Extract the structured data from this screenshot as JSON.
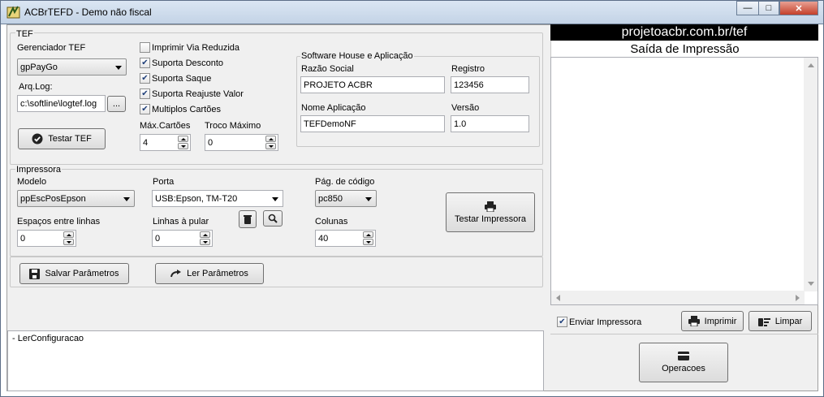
{
  "window": {
    "title": "ACBrTEFD - Demo não fiscal"
  },
  "tef": {
    "group_title": "TEF",
    "gerenciador_label": "Gerenciador TEF",
    "gerenciador_value": "gpPayGo",
    "arqlog_label": "Arq.Log:",
    "arqlog_value": "c:\\softline\\logtef.log",
    "browse_label": "...",
    "testar_label": "Testar TEF",
    "options": [
      {
        "label": "Imprimir Via Reduzida",
        "checked": false
      },
      {
        "label": "Suporta Desconto",
        "checked": true
      },
      {
        "label": "Suporta Saque",
        "checked": true
      },
      {
        "label": "Suporta Reajuste Valor",
        "checked": true
      },
      {
        "label": "Multiplos Cartões",
        "checked": true
      }
    ],
    "max_cartoes_label": "Máx.Cartões",
    "max_cartoes_value": "4",
    "troco_label": "Troco Máximo",
    "troco_value": "0"
  },
  "software_house": {
    "group_title": "Software House e Aplicação",
    "razao_label": "Razão Social",
    "razao_value": "PROJETO ACBR",
    "registro_label": "Registro",
    "registro_value": "123456",
    "nome_label": "Nome Aplicação",
    "nome_value": "TEFDemoNF",
    "versao_label": "Versão",
    "versao_value": "1.0"
  },
  "impressora": {
    "group_title": "Impressora",
    "modelo_label": "Modelo",
    "modelo_value": "ppEscPosEpson",
    "porta_label": "Porta",
    "porta_value": "USB:Epson, TM-T20",
    "pagcod_label": "Pág. de código",
    "pagcod_value": "pc850",
    "espacos_label": "Espaços entre linhas",
    "espacos_value": "0",
    "linhas_label": "Linhas à pular",
    "linhas_value": "0",
    "colunas_label": "Colunas",
    "colunas_value": "40",
    "testar_label": "Testar Impressora"
  },
  "actions": {
    "salvar_label": "Salvar Parâmetros",
    "ler_label": "Ler Parâmetros"
  },
  "log": {
    "text": "- LerConfiguracao"
  },
  "right_panel": {
    "url": "projetoacbr.com.br/tef",
    "saida_title": "Saída de Impressão",
    "enviar_label": "Enviar Impressora",
    "enviar_checked": true,
    "imprimir_label": "Imprimir",
    "limpar_label": "Limpar",
    "operacoes_label": "Operacoes"
  }
}
